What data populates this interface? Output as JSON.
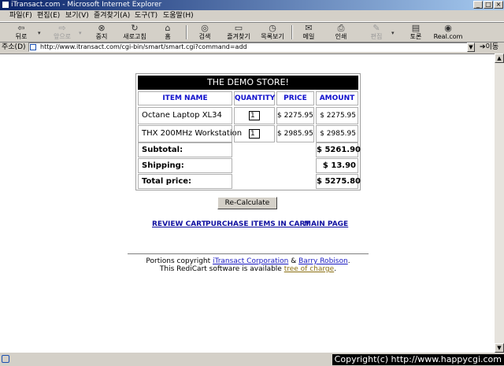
{
  "window": {
    "title": "iTransact.com - Microsoft Internet Explorer",
    "minimize": "_",
    "maximize": "□",
    "close": "×"
  },
  "menu": [
    {
      "label": "파일(F)"
    },
    {
      "label": "편집(E)"
    },
    {
      "label": "보기(V)"
    },
    {
      "label": "즐겨찾기(A)"
    },
    {
      "label": "도구(T)"
    },
    {
      "label": "도움말(H)"
    }
  ],
  "toolbar": {
    "back": "뒤로",
    "forward": "앞으로",
    "stop": "중지",
    "refresh": "새로고침",
    "home": "홈",
    "search": "검색",
    "favorites": "즐겨찾기",
    "history": "목록보기",
    "mail": "메일",
    "print": "인쇄",
    "edit": "편집",
    "discuss": "토론",
    "real": "Real.com"
  },
  "address": {
    "label": "주소(D)",
    "url": "http://www.itransact.com/cgi-bin/smart/smart.cgi?command=add",
    "go": "이동"
  },
  "store": {
    "title": "THE DEMO STORE!",
    "headers": {
      "item": "ITEM NAME",
      "qty": "QUANTITY",
      "price": "PRICE",
      "amount": "AMOUNT"
    },
    "items": [
      {
        "name": "Octane Laptop XL34",
        "qty": "1",
        "price": "$ 2275.95",
        "amount": "$ 2275.95"
      },
      {
        "name": "THX 200MHz Workstation",
        "qty": "1",
        "price": "$ 2985.95",
        "amount": "$ 2985.95"
      }
    ],
    "subtotal_label": "Subtotal:",
    "subtotal": "$ 5261.90",
    "shipping_label": "Shipping:",
    "shipping": "$ 13.90",
    "total_label": "Total price:",
    "total": "$ 5275.80"
  },
  "recalc_label": "Re-Calculate",
  "links": {
    "review": "REVIEW CART",
    "purchase": "PURCHASE ITEMS IN CART",
    "main": "MAIN PAGE"
  },
  "footer": {
    "line1_prefix": "Portions copyright ",
    "corp": "iTransact Corporation",
    "amp": " & ",
    "author": "Barry Robison",
    "line1_suffix": ".",
    "line2_prefix": "This RediCart software is available ",
    "free": "tree of charge",
    "line2_suffix": "."
  },
  "scrollbar": {
    "up": "▲",
    "down": "▼"
  },
  "status": {
    "copyright": "Copyright(c) http://www.happycgi.com"
  }
}
